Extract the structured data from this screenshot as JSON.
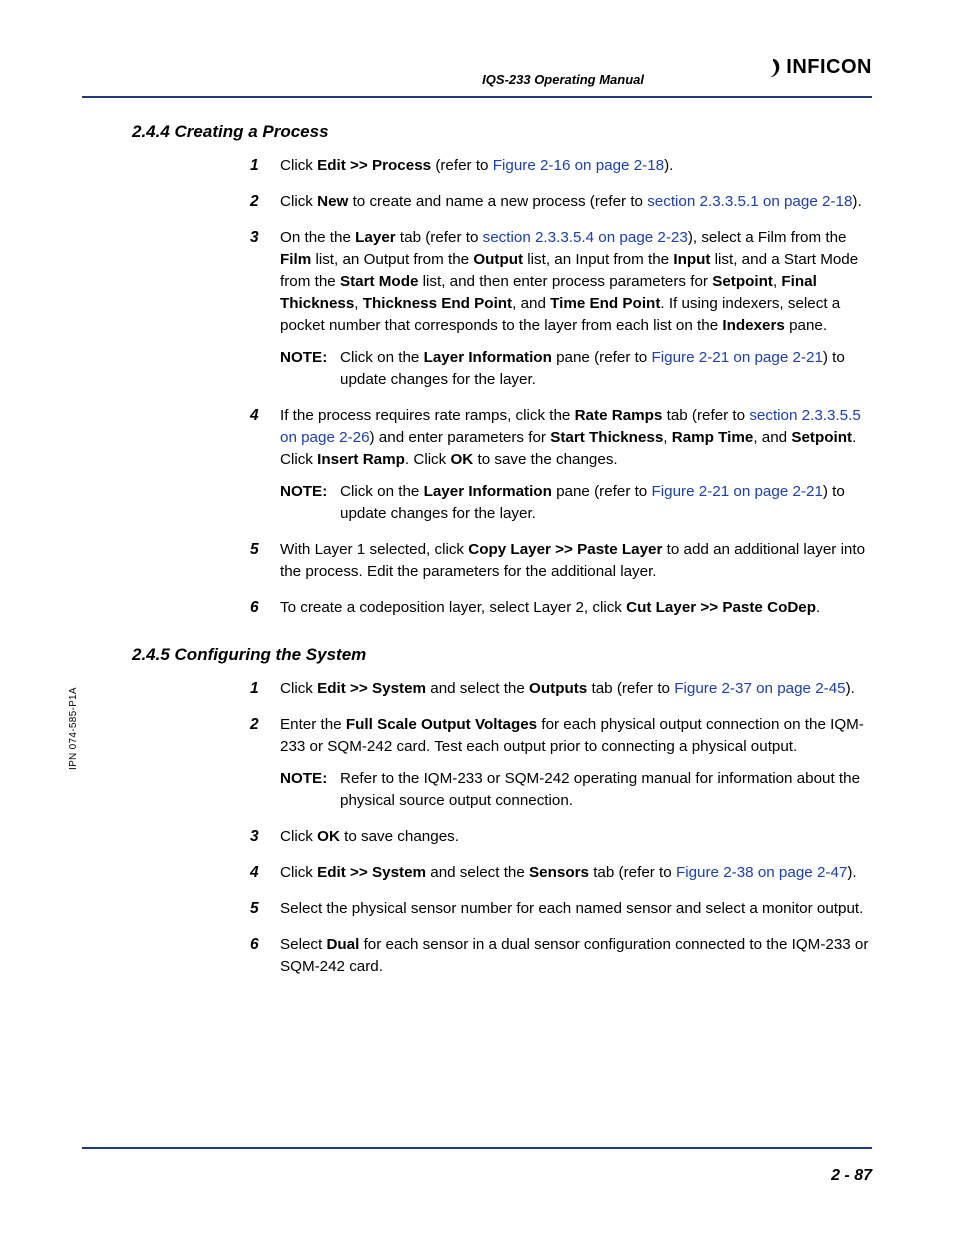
{
  "header": {
    "manual_title": "IQS-233 Operating Manual",
    "brand": "INFICON"
  },
  "ipn": "IPN 074-585-P1A",
  "page_number": "2 - 87",
  "sections": [
    {
      "heading": "2.4.4  Creating a Process",
      "steps": [
        {
          "num": "1",
          "runs": [
            {
              "t": "Click "
            },
            {
              "t": "Edit >> Process",
              "b": true
            },
            {
              "t": " (refer to "
            },
            {
              "t": "Figure 2-16 on page 2-18",
              "link": true
            },
            {
              "t": ")."
            }
          ]
        },
        {
          "num": "2",
          "runs": [
            {
              "t": "Click "
            },
            {
              "t": "New",
              "b": true
            },
            {
              "t": " to create and name a new process (refer to "
            },
            {
              "t": "section 2.3.3.5.1 on page 2-18",
              "link": true
            },
            {
              "t": ")."
            }
          ]
        },
        {
          "num": "3",
          "runs": [
            {
              "t": "On the the "
            },
            {
              "t": "Layer",
              "b": true
            },
            {
              "t": " tab (refer to "
            },
            {
              "t": "section 2.3.3.5.4 on page 2-23",
              "link": true
            },
            {
              "t": "), select a Film from the "
            },
            {
              "t": "Film",
              "b": true
            },
            {
              "t": " list, an Output from the "
            },
            {
              "t": "Output",
              "b": true
            },
            {
              "t": " list, an Input from the "
            },
            {
              "t": "Input",
              "b": true
            },
            {
              "t": " list, and a Start Mode from the "
            },
            {
              "t": "Start Mode",
              "b": true
            },
            {
              "t": " list, and then enter process parameters for "
            },
            {
              "t": "Setpoint",
              "b": true
            },
            {
              "t": ", "
            },
            {
              "t": "Final Thickness",
              "b": true
            },
            {
              "t": ", "
            },
            {
              "t": "Thickness End Point",
              "b": true
            },
            {
              "t": ", and "
            },
            {
              "t": "Time End Point",
              "b": true
            },
            {
              "t": ". If using indexers, select a pocket number that corresponds to the layer from each list on the "
            },
            {
              "t": "Indexers",
              "b": true
            },
            {
              "t": " pane."
            }
          ],
          "note": {
            "label": "NOTE:",
            "runs": [
              {
                "t": "Click on the "
              },
              {
                "t": "Layer Information",
                "b": true
              },
              {
                "t": " pane (refer to "
              },
              {
                "t": "Figure 2-21 on page 2-21",
                "link": true
              },
              {
                "t": ") to update changes for the layer."
              }
            ]
          }
        },
        {
          "num": "4",
          "runs": [
            {
              "t": "If the process requires rate ramps, click the "
            },
            {
              "t": "Rate Ramps",
              "b": true
            },
            {
              "t": " tab (refer to "
            },
            {
              "t": "section 2.3.3.5.5 on page 2-26",
              "link": true
            },
            {
              "t": ") and enter parameters for "
            },
            {
              "t": "Start Thickness",
              "b": true
            },
            {
              "t": ", "
            },
            {
              "t": "Ramp Time",
              "b": true
            },
            {
              "t": ", and "
            },
            {
              "t": "Setpoint",
              "b": true
            },
            {
              "t": ". Click "
            },
            {
              "t": "Insert Ramp",
              "b": true
            },
            {
              "t": ". Click "
            },
            {
              "t": "OK",
              "b": true
            },
            {
              "t": " to save the changes."
            }
          ],
          "note": {
            "label": "NOTE:",
            "runs": [
              {
                "t": "Click on the "
              },
              {
                "t": "Layer Information",
                "b": true
              },
              {
                "t": " pane (refer to "
              },
              {
                "t": "Figure 2-21 on page 2-21",
                "link": true
              },
              {
                "t": ") to update changes for the layer."
              }
            ]
          }
        },
        {
          "num": "5",
          "runs": [
            {
              "t": "With Layer 1 selected, click "
            },
            {
              "t": "Copy Layer >> Paste Layer",
              "b": true
            },
            {
              "t": " to add an additional layer into the process. Edit the parameters for the additional layer."
            }
          ]
        },
        {
          "num": "6",
          "runs": [
            {
              "t": "To create a codeposition layer, select Layer 2, click "
            },
            {
              "t": "Cut Layer >> Paste CoDep",
              "b": true
            },
            {
              "t": "."
            }
          ]
        }
      ]
    },
    {
      "heading": "2.4.5  Configuring the System",
      "steps": [
        {
          "num": "1",
          "runs": [
            {
              "t": "Click "
            },
            {
              "t": "Edit >> System",
              "b": true
            },
            {
              "t": " and select the "
            },
            {
              "t": "Outputs",
              "b": true
            },
            {
              "t": " tab (refer to "
            },
            {
              "t": "Figure 2-37 on page 2-45",
              "link": true
            },
            {
              "t": ")."
            }
          ]
        },
        {
          "num": "2",
          "runs": [
            {
              "t": "Enter the "
            },
            {
              "t": "Full Scale Output Voltages",
              "b": true
            },
            {
              "t": " for each physical output connection on the IQM-233 or SQM-242 card. Test each output prior to connecting a physical output."
            }
          ],
          "note": {
            "label": "NOTE:",
            "runs": [
              {
                "t": "Refer to the IQM-233 or SQM-242 operating manual for information about the physical source output connection."
              }
            ]
          }
        },
        {
          "num": "3",
          "runs": [
            {
              "t": "Click "
            },
            {
              "t": "OK",
              "b": true
            },
            {
              "t": " to save changes."
            }
          ]
        },
        {
          "num": "4",
          "runs": [
            {
              "t": "Click "
            },
            {
              "t": "Edit >> System",
              "b": true
            },
            {
              "t": " and select the "
            },
            {
              "t": "Sensors",
              "b": true
            },
            {
              "t": " tab (refer to "
            },
            {
              "t": "Figure 2-38 on page 2-47",
              "link": true
            },
            {
              "t": ")."
            }
          ]
        },
        {
          "num": "5",
          "runs": [
            {
              "t": "Select the physical sensor number for each named sensor and select a monitor output."
            }
          ]
        },
        {
          "num": "6",
          "runs": [
            {
              "t": "Select "
            },
            {
              "t": "Dual",
              "b": true
            },
            {
              "t": " for each sensor in a dual sensor configuration connected to the IQM-233 or SQM-242 card."
            }
          ]
        }
      ]
    }
  ]
}
